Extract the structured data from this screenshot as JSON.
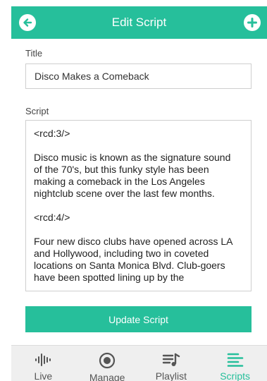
{
  "colors": {
    "accent": "#26bf9b",
    "tab_inactive": "#555555"
  },
  "header": {
    "title": "Edit Script",
    "back_icon": "arrow-left-icon",
    "add_icon": "plus-icon"
  },
  "form": {
    "title_label": "Title",
    "title_value": "Disco Makes a Comeback",
    "script_label": "Script",
    "script_paragraphs": [
      "<rcd:3/>",
      "Disco music is known as the signature sound of the 70's, but this funky style has been making a comeback in the Los Angeles nightclub scene over the last few months.",
      "<rcd:4/>",
      "Four new disco clubs have opened across LA and Hollywood, including two in coveted locations on Santa Monica Blvd. Club-goers have been spotted lining up by the"
    ],
    "submit_label": "Update Script"
  },
  "tabs": [
    {
      "label": "Live",
      "icon": "waveform-icon",
      "active": false
    },
    {
      "label": "Manage",
      "icon": "record-icon",
      "active": false
    },
    {
      "label": "Playlist",
      "icon": "playlist-icon",
      "active": false
    },
    {
      "label": "Scripts",
      "icon": "lines-icon",
      "active": true
    }
  ]
}
